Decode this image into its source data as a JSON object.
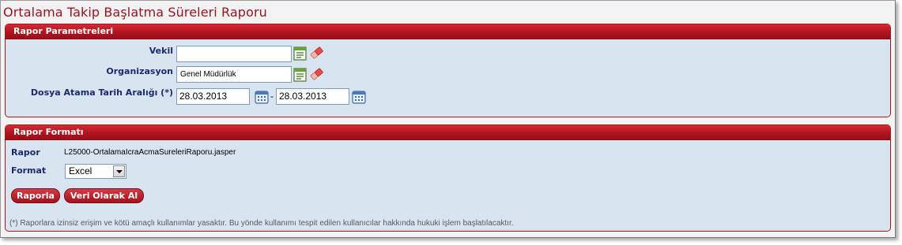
{
  "page": {
    "title": "Ortalama Takip Başlatma Süreleri Raporu"
  },
  "params_panel": {
    "title": "Rapor Parametreleri",
    "vekil": {
      "label": "Vekil",
      "value": ""
    },
    "organizasyon": {
      "label": "Organizasyon",
      "value": "Genel Müdürlük"
    },
    "date_range": {
      "label": "Dosya Atama Tarih Aralığı (*)",
      "start": "28.03.2013",
      "separator": "-",
      "end": "28.03.2013"
    }
  },
  "format_panel": {
    "title": "Rapor Formatı",
    "rapor_label": "Rapor",
    "rapor_value": "L25000-OrtalamaIcraAcmaSureleriRaporu.jasper",
    "format_label": "Format",
    "format_selected": "Excel",
    "buttons": {
      "raporla": "Raporla",
      "veri": "Veri Olarak Al"
    },
    "footnote": "(*) Raporlara izinsiz erişim ve kötü amaçlı kullanımlar yasaktır. Bu yönde kullanımı tespit edilen kullanıcılar hakkında hukuki işlem başlatılacaktır."
  },
  "colors": {
    "accent": "#b0141e",
    "panel_bg": "#d9e4f1",
    "label": "#1c2a6e"
  },
  "icons": [
    "list-lookup-icon",
    "eraser-icon",
    "calendar-icon",
    "dropdown-arrow-icon"
  ]
}
